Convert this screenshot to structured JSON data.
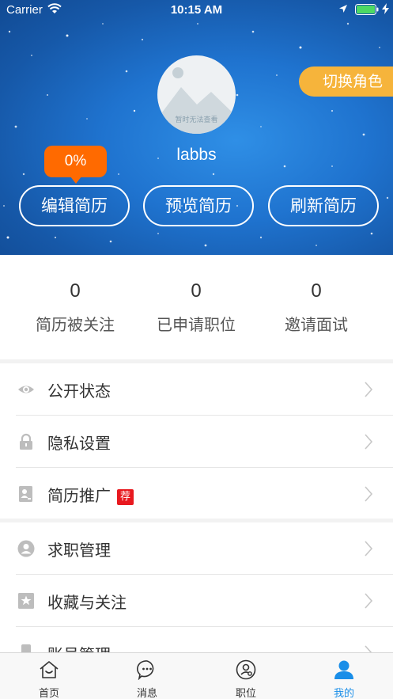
{
  "status_bar": {
    "carrier": "Carrier",
    "time": "10:15 AM"
  },
  "header": {
    "switch_role_label": "切换角色",
    "avatar_caption": "暂时无法查看",
    "username": "labbs",
    "resume_completeness": "0%",
    "buttons": {
      "edit": "编辑简历",
      "preview": "预览简历",
      "refresh": "刷新简历"
    }
  },
  "stats": [
    {
      "value": "0",
      "label": "简历被关注"
    },
    {
      "value": "0",
      "label": "已申请职位"
    },
    {
      "value": "0",
      "label": "邀请面试"
    }
  ],
  "menu": {
    "group1": [
      {
        "label": "公开状态",
        "icon": "eye-icon"
      },
      {
        "label": "隐私设置",
        "icon": "lock-icon"
      },
      {
        "label": "简历推广",
        "icon": "resume-promote-icon",
        "badge": "荐"
      }
    ],
    "group2": [
      {
        "label": "求职管理",
        "icon": "user-circle-icon"
      },
      {
        "label": "收藏与关注",
        "icon": "star-bookmark-icon"
      },
      {
        "label": "账号管理",
        "icon": "phone-icon"
      }
    ]
  },
  "tabbar": {
    "tabs": [
      {
        "label": "首页",
        "icon": "home-icon"
      },
      {
        "label": "消息",
        "icon": "message-icon"
      },
      {
        "label": "职位",
        "icon": "job-icon"
      },
      {
        "label": "我的",
        "icon": "profile-icon",
        "active": true
      }
    ]
  },
  "colors": {
    "header_blue": "#1f73cf",
    "switch_role": "#f6b43b",
    "completeness_badge": "#ff6a00",
    "recommend_badge": "#e8191f",
    "active_tab": "#1a8ee8"
  }
}
